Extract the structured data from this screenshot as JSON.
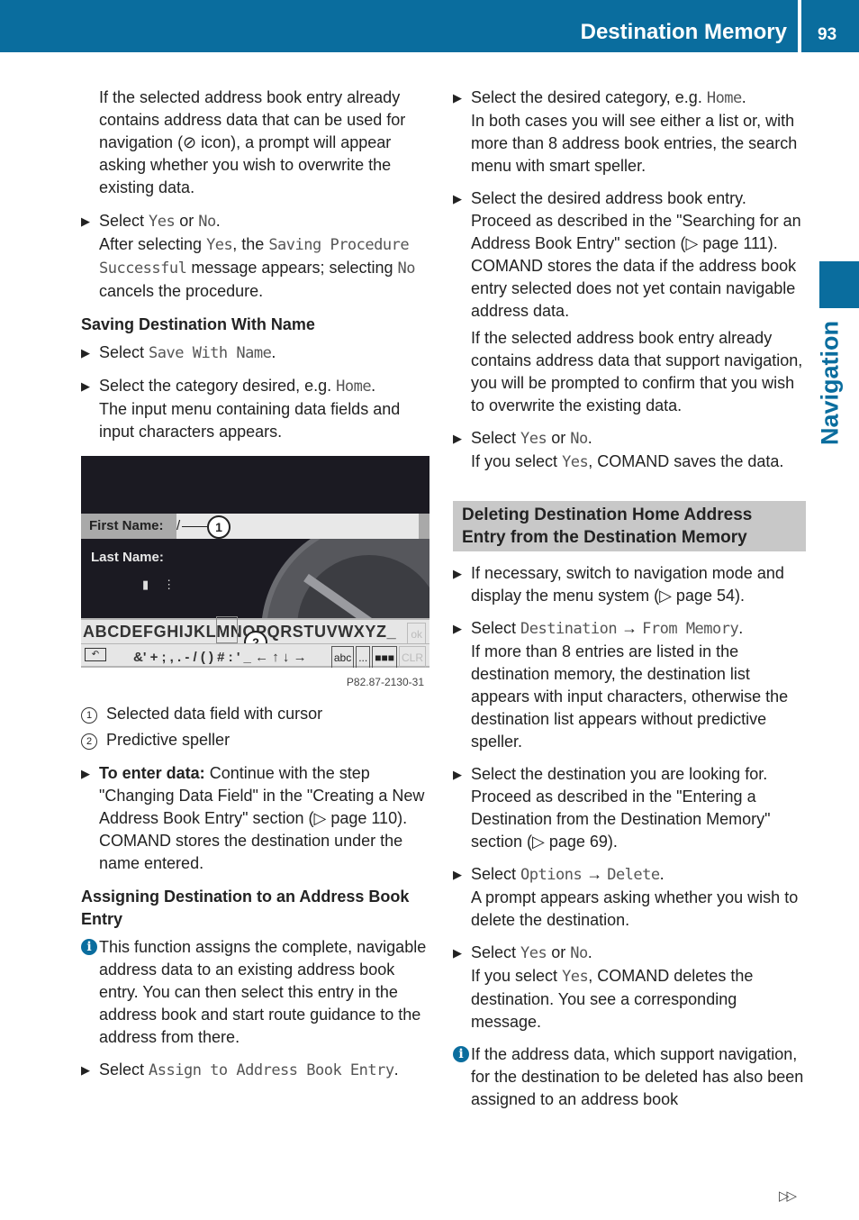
{
  "header": {
    "title": "Destination Memory",
    "page_number": "93"
  },
  "side_tab": {
    "label": "Navigation"
  },
  "left": {
    "intro": "If the selected address book entry already contains address data that can be used for navigation (⊘ icon), a prompt will appear asking whether you wish to overwrite the existing data.",
    "b1": {
      "pre": "Select ",
      "m1": "Yes",
      "mid": " or ",
      "m2": "No",
      "end": ".",
      "l2pre": "After selecting ",
      "l2m1": "Yes",
      "l2mid": ", the ",
      "l2m2": "Saving Procedure Successful",
      "l2post": " message appears; selecting ",
      "l2m3": "No",
      "l2end": " cancels the procedure."
    },
    "h_saving": "Saving Destination With Name",
    "b2": {
      "pre": "Select ",
      "m": "Save With Name",
      "end": "."
    },
    "b3": {
      "pre": "Select the category desired, e.g. ",
      "m": "Home",
      "end": ".",
      "rest": "The input menu containing data fields and input characters appears."
    },
    "figure": {
      "first_name_label": "First Name:",
      "cursor": "/",
      "last_name_label": "Last Name:",
      "callout1": "1",
      "callout2": "2",
      "row1": "ABCDEFGHIJKLMNOPQRSTUVWXYZ_",
      "ok": "ok",
      "row2_symbols": "&' + ; , . - / ( ) # : ' _ ← ↑ ↓ →",
      "btn_abc": "abc",
      "btn_more": "...",
      "btn_clr": "CLR",
      "id": "P82.87-2130-31"
    },
    "legend": [
      {
        "num": "1",
        "text": "Selected data field with cursor"
      },
      {
        "num": "2",
        "text": "Predictive speller"
      }
    ],
    "b4": {
      "bold": "To enter data:",
      "rest": " Continue with the step \"Changing Data Field\" in the \"Creating a New Address Book Entry\" section (▷ page 110).",
      "rest2": "COMAND stores the destination under the name entered."
    },
    "h_assign": "Assigning Destination to an Address Book Entry",
    "info1": "This function assigns the complete, navigable address data to an existing address book entry. You can then select this entry in the address book and start route guidance to the address from there.",
    "b5": {
      "pre": "Select ",
      "m": "Assign to Address Book Entry",
      "end": "."
    }
  },
  "right": {
    "b1": {
      "pre": "Select the desired category, e.g. ",
      "m": "Home",
      "end": ".",
      "rest": "In both cases you will see either a list or, with more than 8 address book entries, the search menu with smart speller."
    },
    "b2": {
      "l1": "Select the desired address book entry.",
      "l2": "Proceed as described in the \"Searching for an Address Book Entry\" section (▷ page 111).",
      "l3": "COMAND stores the data if the address book entry selected does not yet contain navigable address data.",
      "l4": "If the selected address book entry already contains address data that support navigation, you will be prompted to confirm that you wish to overwrite the existing data."
    },
    "b3": {
      "pre": "Select ",
      "m1": "Yes",
      "mid": " or ",
      "m2": "No",
      "end": ".",
      "l2pre": "If you select ",
      "l2m": "Yes",
      "l2post": ", COMAND saves the data."
    },
    "section_title": "Deleting Destination Home Address Entry from the Destination Memory",
    "b4": "If necessary, switch to navigation mode and display the menu system (▷ page 54).",
    "b5": {
      "pre": "Select ",
      "m1": "Destination",
      "arrow": " → ",
      "m2": "From Memory",
      "end": ".",
      "rest": "If more than 8 entries are listed in the destination memory, the destination list appears with input characters, otherwise the destination list appears without predictive speller."
    },
    "b6": {
      "l1": "Select the destination you are looking for.",
      "l2": "Proceed as described in the \"Entering a Destination from the Destination Memory\" section (▷ page 69)."
    },
    "b7": {
      "pre": "Select ",
      "m1": "Options",
      "arrow": " → ",
      "m2": "Delete",
      "end": ".",
      "rest": "A prompt appears asking whether you wish to delete the destination."
    },
    "b8": {
      "pre": "Select ",
      "m1": "Yes",
      "mid": " or ",
      "m2": "No",
      "end": ".",
      "l2pre": "If you select ",
      "l2m": "Yes",
      "l2post": ", COMAND deletes the destination. You see a corresponding message."
    },
    "info1": "If the address data, which support navigation, for the destination to be deleted has also been assigned to an address book"
  },
  "footer": {
    "continue_marker": "▷▷"
  }
}
